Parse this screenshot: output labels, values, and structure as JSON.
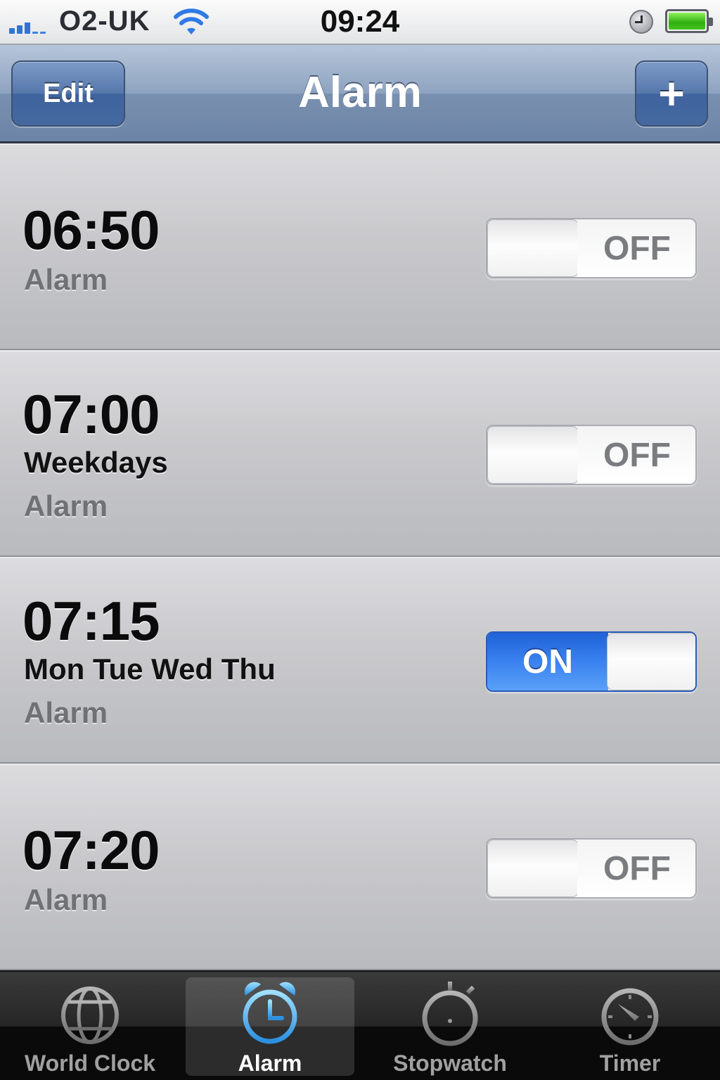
{
  "status": {
    "carrier": "O2-UK",
    "time": "09:24"
  },
  "nav": {
    "title": "Alarm",
    "edit_label": "Edit",
    "add_label": "+"
  },
  "alarms": [
    {
      "time": "06:50",
      "repeat": "",
      "label": "Alarm",
      "state": "OFF"
    },
    {
      "time": "07:00",
      "repeat": "Weekdays",
      "label": "Alarm",
      "state": "OFF"
    },
    {
      "time": "07:15",
      "repeat": "Mon Tue Wed Thu",
      "label": "Alarm",
      "state": "ON"
    },
    {
      "time": "07:20",
      "repeat": "",
      "label": "Alarm",
      "state": "OFF"
    }
  ],
  "tabs": [
    {
      "label": "World Clock",
      "icon": "globe-icon",
      "selected": false
    },
    {
      "label": "Alarm",
      "icon": "alarm-clock-icon",
      "selected": true
    },
    {
      "label": "Stopwatch",
      "icon": "stopwatch-icon",
      "selected": false
    },
    {
      "label": "Timer",
      "icon": "timer-icon",
      "selected": false
    }
  ],
  "colors": {
    "accent": "#2f7ae5",
    "navbar": "#7990b0",
    "tab_selected": "#3fb2f3"
  }
}
